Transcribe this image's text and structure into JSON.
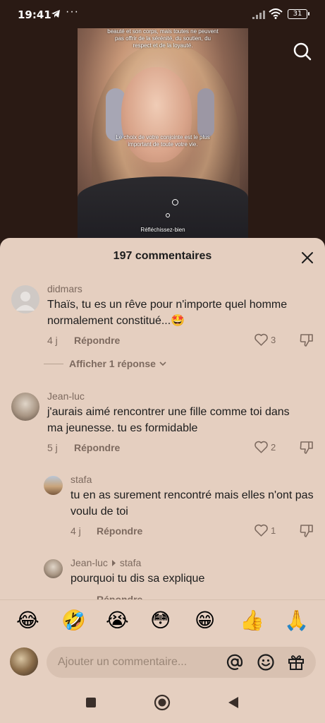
{
  "status_bar": {
    "time": "19:41",
    "more": "···",
    "battery": "31"
  },
  "video": {
    "caption_top": "beauté et son corps, mais toutes ne peuvent pas offrir de la sérénité, du soutien, du respect et de la loyauté.",
    "caption_middle": "Le choix de votre conjointe est le plus important de toute votre vie.",
    "caption_bottom": "Réfléchissez-bien"
  },
  "sheet": {
    "title": "197 commentaires",
    "comments": [
      {
        "user": "didmars",
        "text": "Thaïs, tu es un rêve pour n'importe quel homme normalement constitué...🤩",
        "age": "4 j",
        "reply_label": "Répondre",
        "likes": "3"
      },
      {
        "user": "Jean-luc",
        "text": "j'aurais aimé rencontrer une fille comme toi dans ma jeunesse. tu es formidable",
        "age": "5 j",
        "reply_label": "Répondre",
        "likes": "2"
      },
      {
        "user": "stafa",
        "text": "tu en as surement rencontré mais elles n'ont pas voulu de toi",
        "age": "4 j",
        "reply_label": "Répondre",
        "likes": "1"
      },
      {
        "user": "Jean-luc",
        "reply_to": "stafa",
        "text": "pourquoi tu dis sa explique",
        "reply_label": "Répondre"
      }
    ],
    "show_replies": "Afficher 1 réponse"
  },
  "emoji_bar": [
    "😂",
    "🤣",
    "😭",
    "😳",
    "😁",
    "👍",
    "🙏"
  ],
  "composer": {
    "placeholder": "Ajouter un commentaire..."
  },
  "colors": {
    "sheet_bg": "#e5cfc0",
    "text": "#1c1c1c",
    "muted": "#7d6a5f",
    "input_bg": "#d8c1b1"
  }
}
